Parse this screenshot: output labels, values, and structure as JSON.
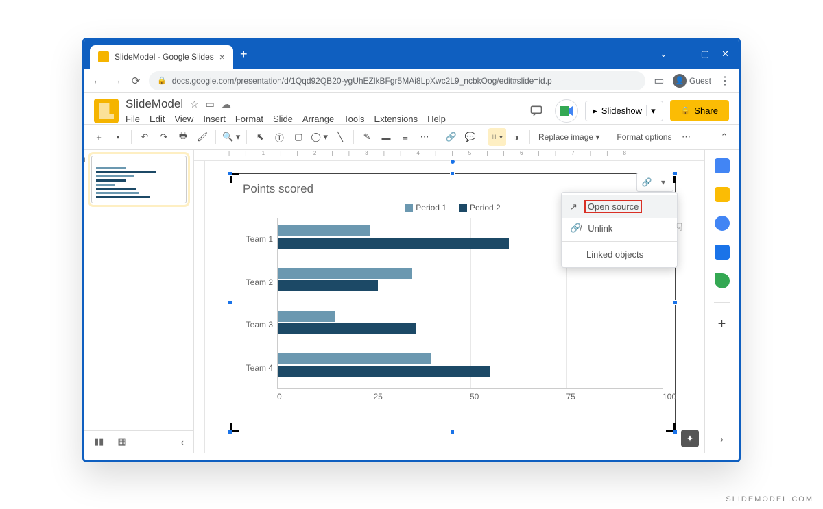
{
  "browser": {
    "tab_title": "SlideModel - Google Slides",
    "url": "docs.google.com/presentation/d/1Qqd92QB20-ygUhEZlkBFgr5MAi8LpXwc2L9_ncbkOog/edit#slide=id.p",
    "guest_label": "Guest"
  },
  "app": {
    "doc_title": "SlideModel",
    "menubar": [
      "File",
      "Edit",
      "View",
      "Insert",
      "Format",
      "Slide",
      "Arrange",
      "Tools",
      "Extensions",
      "Help"
    ],
    "slideshow_label": "Slideshow",
    "share_label": "Share"
  },
  "toolbar": {
    "replace_image": "Replace image",
    "format_options": "Format options"
  },
  "thumb": {
    "num": "1"
  },
  "link_menu": {
    "open_source": "Open source",
    "unlink": "Unlink",
    "linked_objects": "Linked objects"
  },
  "chart_data": {
    "type": "bar",
    "title": "Points scored",
    "categories": [
      "Team 1",
      "Team 2",
      "Team 3",
      "Team 4"
    ],
    "series": [
      {
        "name": "Period 1",
        "color": "#6b98b0",
        "values": [
          24,
          35,
          15,
          40
        ]
      },
      {
        "name": "Period 2",
        "color": "#1c4966",
        "values": [
          60,
          26,
          36,
          55
        ]
      }
    ],
    "xlim": [
      0,
      100
    ],
    "x_ticks": [
      0,
      25,
      50,
      75,
      100
    ]
  },
  "colors": {
    "accent": "#0f5fc0",
    "share": "#fbbc04",
    "highlight": "#d93025"
  },
  "watermark": "SLIDEMODEL.COM"
}
